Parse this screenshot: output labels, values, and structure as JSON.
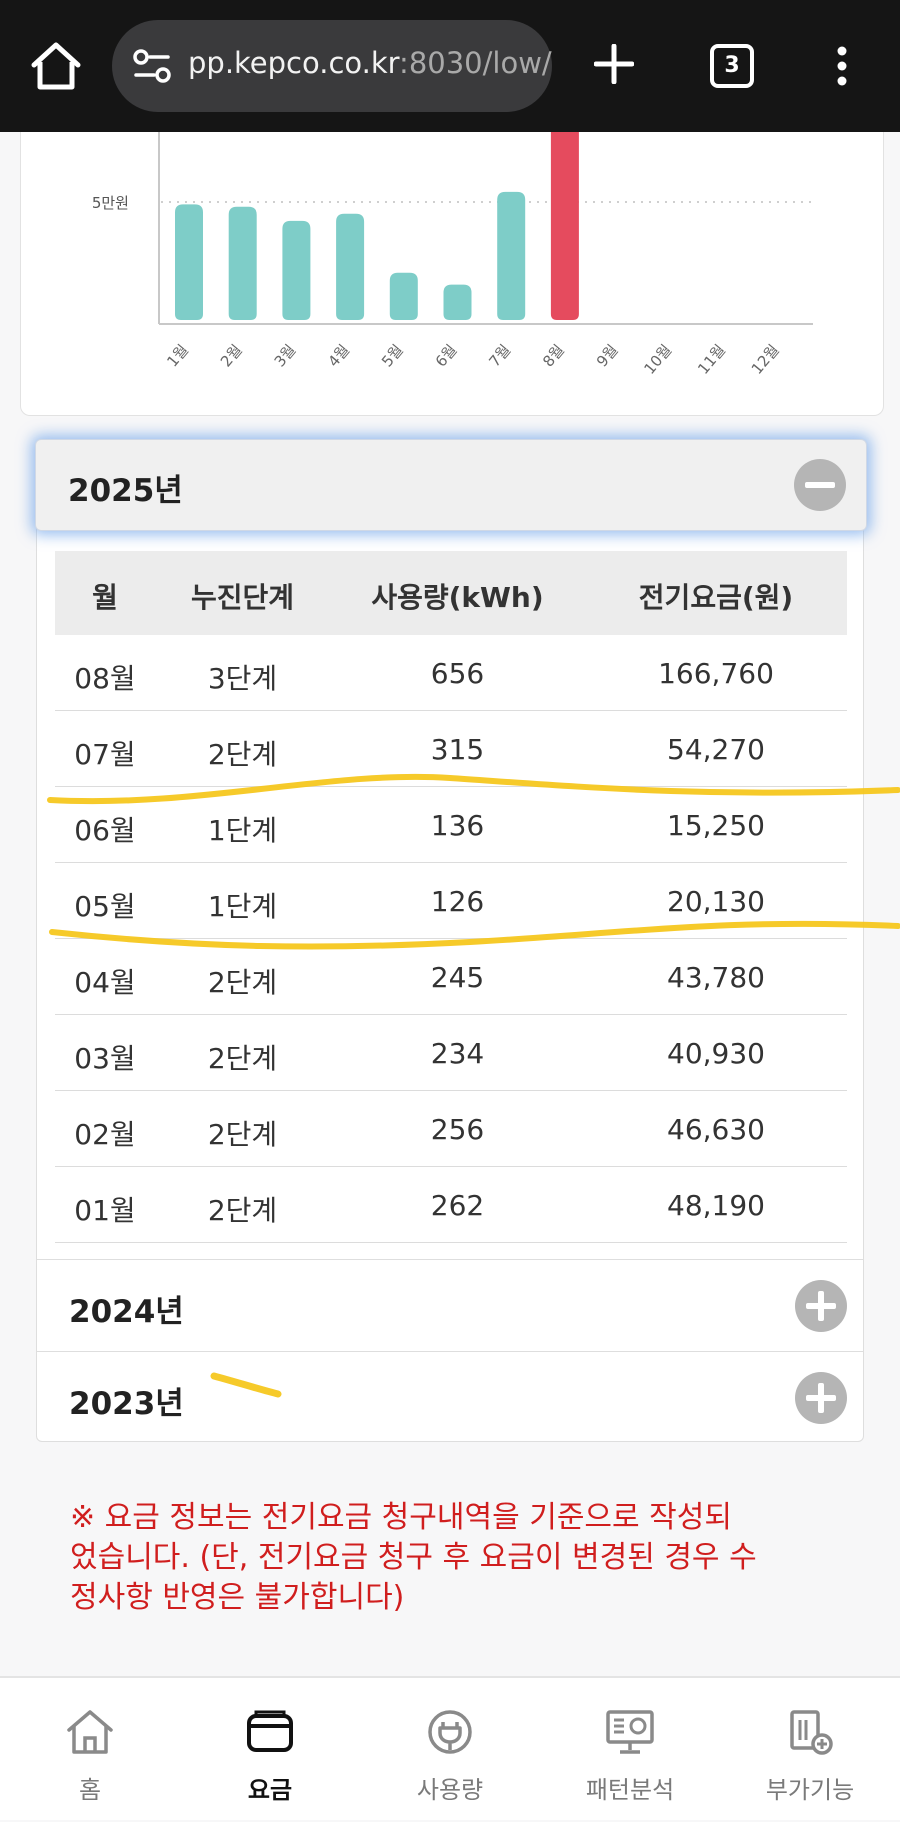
{
  "browser": {
    "url_main": "pp.kepco.co.kr",
    "url_rest": ":8030/low/",
    "tab_count": "3"
  },
  "chart_data": {
    "type": "bar",
    "categories": [
      "1월",
      "2월",
      "3월",
      "4월",
      "5월",
      "6월",
      "7월",
      "8월",
      "9월",
      "10월",
      "11월",
      "12월"
    ],
    "values": [
      49000,
      48000,
      42000,
      45000,
      20000,
      15000,
      54270,
      166760,
      null,
      null,
      null,
      null
    ],
    "ylabel_tick": "5만원",
    "reference_line": 50000,
    "colors": {
      "normal": "#7ecdc8",
      "current": "#e54b5e"
    },
    "highlight_index": 7
  },
  "accordion": {
    "open": {
      "title": "2025년",
      "columns": [
        "월",
        "누진단계",
        "사용량(kWh)",
        "전기요금(원)"
      ],
      "rows": [
        {
          "month": "08월",
          "stage": "3단계",
          "usage": "656",
          "fee": "166,760"
        },
        {
          "month": "07월",
          "stage": "2단계",
          "usage": "315",
          "fee": "54,270"
        },
        {
          "month": "06월",
          "stage": "1단계",
          "usage": "136",
          "fee": "15,250"
        },
        {
          "month": "05월",
          "stage": "1단계",
          "usage": "126",
          "fee": "20,130"
        },
        {
          "month": "04월",
          "stage": "2단계",
          "usage": "245",
          "fee": "43,780"
        },
        {
          "month": "03월",
          "stage": "2단계",
          "usage": "234",
          "fee": "40,930"
        },
        {
          "month": "02월",
          "stage": "2단계",
          "usage": "256",
          "fee": "46,630"
        },
        {
          "month": "01월",
          "stage": "2단계",
          "usage": "262",
          "fee": "48,190"
        }
      ]
    },
    "collapsed": [
      {
        "title": "2024년"
      },
      {
        "title": "2023년"
      }
    ]
  },
  "notice": {
    "line1": "※ 요금 정보는 전기요금 청구내역을 기준으로 작성되",
    "line2": "었습니다. (단, 전기요금 청구 후 요금이 변경된 경우 수",
    "line3": "정사항 반영은 불가합니다)"
  },
  "nav": {
    "items": [
      {
        "label": "홈"
      },
      {
        "label": "요금"
      },
      {
        "label": "사용량"
      },
      {
        "label": "패턴분석"
      },
      {
        "label": "부가기능"
      }
    ],
    "active_index": 1
  },
  "colors": {
    "annotation": "#f5c518",
    "notice": "#d01e1e"
  }
}
